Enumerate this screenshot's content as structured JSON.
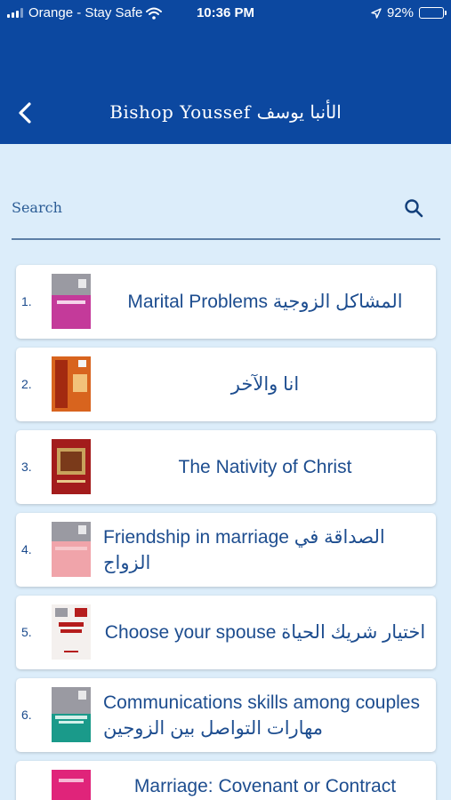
{
  "status": {
    "carrier": "Orange - Stay Safe",
    "time": "10:36 PM",
    "battery": "92%",
    "battery_level": 0.92
  },
  "header": {
    "title": "Bishop Youssef الأنبا يوسف"
  },
  "search": {
    "placeholder": "Search"
  },
  "items": [
    {
      "number": "1.",
      "title": "Marital Problems المشاكل الزوجية",
      "cover_colors": [
        "#9a9aa2",
        "#c43a9a"
      ]
    },
    {
      "number": "2.",
      "title": "انا والآخر",
      "cover_colors": [
        "#d8641e",
        "#a32a10"
      ]
    },
    {
      "number": "3.",
      "title": "The Nativity of Christ",
      "cover_colors": [
        "#a31c1c",
        "#c8a25c"
      ]
    },
    {
      "number": "4.",
      "title": "Friendship in marriage  الصداقة في الزواج",
      "cover_colors": [
        "#9a9aa2",
        "#f0a4aa"
      ]
    },
    {
      "number": "5.",
      "title": "Choose your spouse اختيار شريك الحياة",
      "cover_colors": [
        "#f4f0ee",
        "#b51d1d"
      ]
    },
    {
      "number": "6.",
      "title": "Communications skills among couples مهارات التواصل بين الزوجين",
      "cover_colors": [
        "#9a9aa2",
        "#1a9a8a"
      ]
    },
    {
      "number": "",
      "title": "Marriage: Covenant or Contract",
      "cover_colors": [
        "#e0247a",
        "#e0247a"
      ]
    }
  ],
  "colors": {
    "header_bg": "#0c48a0",
    "page_bg": "#dcedfa",
    "text": "#1d4d8f"
  }
}
